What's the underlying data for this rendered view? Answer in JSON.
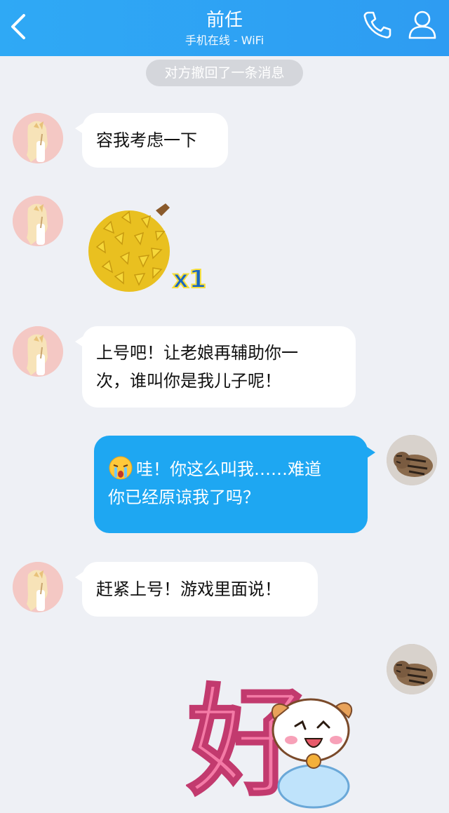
{
  "header": {
    "title": "前任",
    "subtitle": "手机在线 - WiFi",
    "back_icon": "chevron-left-icon",
    "call_icon": "phone-icon",
    "profile_icon": "user-icon",
    "bg": "#2fa9f5"
  },
  "notice": "对方撤回了一条消息",
  "messages": [
    {
      "from": "her",
      "text": "容我考虑一下"
    },
    {
      "from": "her",
      "gift_label": "x1",
      "gift_icon": "durian-icon"
    },
    {
      "from": "her",
      "line1": "上号吧！让老娘再辅助你一",
      "line2": "次，谁叫你是我儿子呢！"
    },
    {
      "from": "me",
      "line1": "哇！你这么叫我……难道",
      "line2": "你已经原谅我了吗？",
      "emoji": "crying-face-icon"
    },
    {
      "from": "her",
      "text": "赶紧上号！游戏里面说！"
    },
    {
      "from": "me",
      "sticker_text": "好",
      "sticker_icon": "puppy-sticker-icon"
    }
  ],
  "colors": {
    "out_bubble": "#1ea7f2",
    "in_bubble": "#ffffff",
    "background": "#eef0f5"
  }
}
